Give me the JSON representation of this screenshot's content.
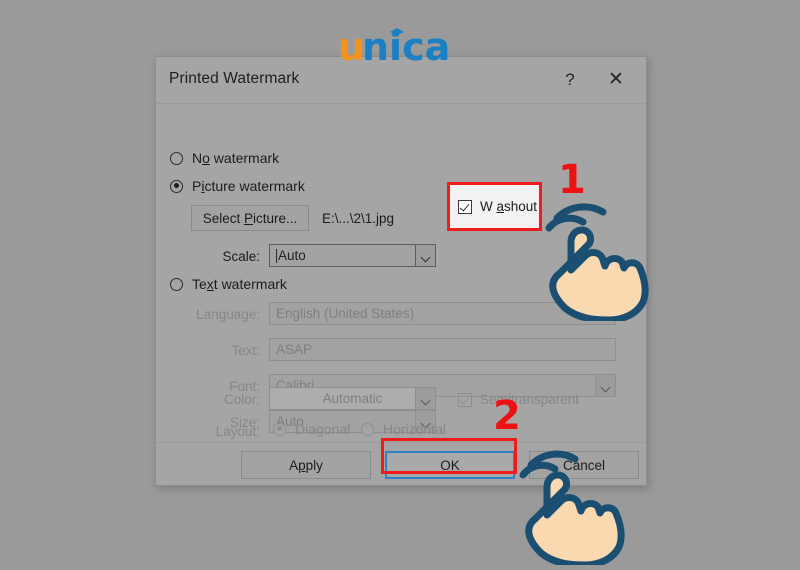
{
  "background": {
    "color": "#9a9a9a"
  },
  "logo": {
    "text": "unica",
    "part_one": "u",
    "part_two": "nica",
    "color_orange": "#F5921E",
    "color_blue": "#1B7FC4"
  },
  "dialog": {
    "title": "Printed Watermark",
    "help_icon_label": "?",
    "close_icon_label": "✕",
    "options": {
      "no_watermark": {
        "label_pre": "N",
        "label_underline": "o",
        "label_post": " watermark",
        "full": "No watermark",
        "selected": false
      },
      "picture_watermark": {
        "label_pre": "P",
        "label_underline": "i",
        "label_post": "cture watermark",
        "full": "Picture watermark",
        "selected": true
      },
      "text_watermark": {
        "label_pre": "Te",
        "label_underline": "x",
        "label_post": "t watermark",
        "full": "Text watermark",
        "selected": false
      }
    },
    "picture_section": {
      "select_picture_button": {
        "pre": "Select ",
        "underline": "P",
        "post": "icture...",
        "full": "Select Picture..."
      },
      "file_path": "E:\\...\\2\\1.jpg",
      "scale_label": "Scale:",
      "scale_value": "Auto",
      "washout": {
        "label_pre": "W",
        "label_underline": "a",
        "label_post": "shout",
        "full": "Washout",
        "checked": true,
        "enabled": true
      }
    },
    "text_section": {
      "language_label": "Language:",
      "language_value": "English (United States)",
      "text_label": "Text:",
      "text_value": "ASAP",
      "font_label": "Font:",
      "font_value": "Calibri",
      "size_label": "Size:",
      "size_value": "Auto",
      "color_label": "Color:",
      "color_value": "Automatic",
      "semitransparent": {
        "label": "Semitransparent",
        "checked": true,
        "enabled": false
      },
      "layout_label": "Layout:",
      "layout_diagonal": {
        "label": "Diagonal",
        "selected": true
      },
      "layout_horizontal": {
        "label": "Horizontal",
        "selected": false
      }
    },
    "footer": {
      "apply": {
        "pre": "A",
        "underline": "p",
        "post": "ply",
        "full": "Apply"
      },
      "ok": "OK",
      "cancel": "Cancel"
    }
  },
  "annotations": {
    "step_one": "1",
    "step_two": "2",
    "highlight_color": "#ee1c1c",
    "targets": [
      "washout-checkbox",
      "ok-button"
    ]
  }
}
